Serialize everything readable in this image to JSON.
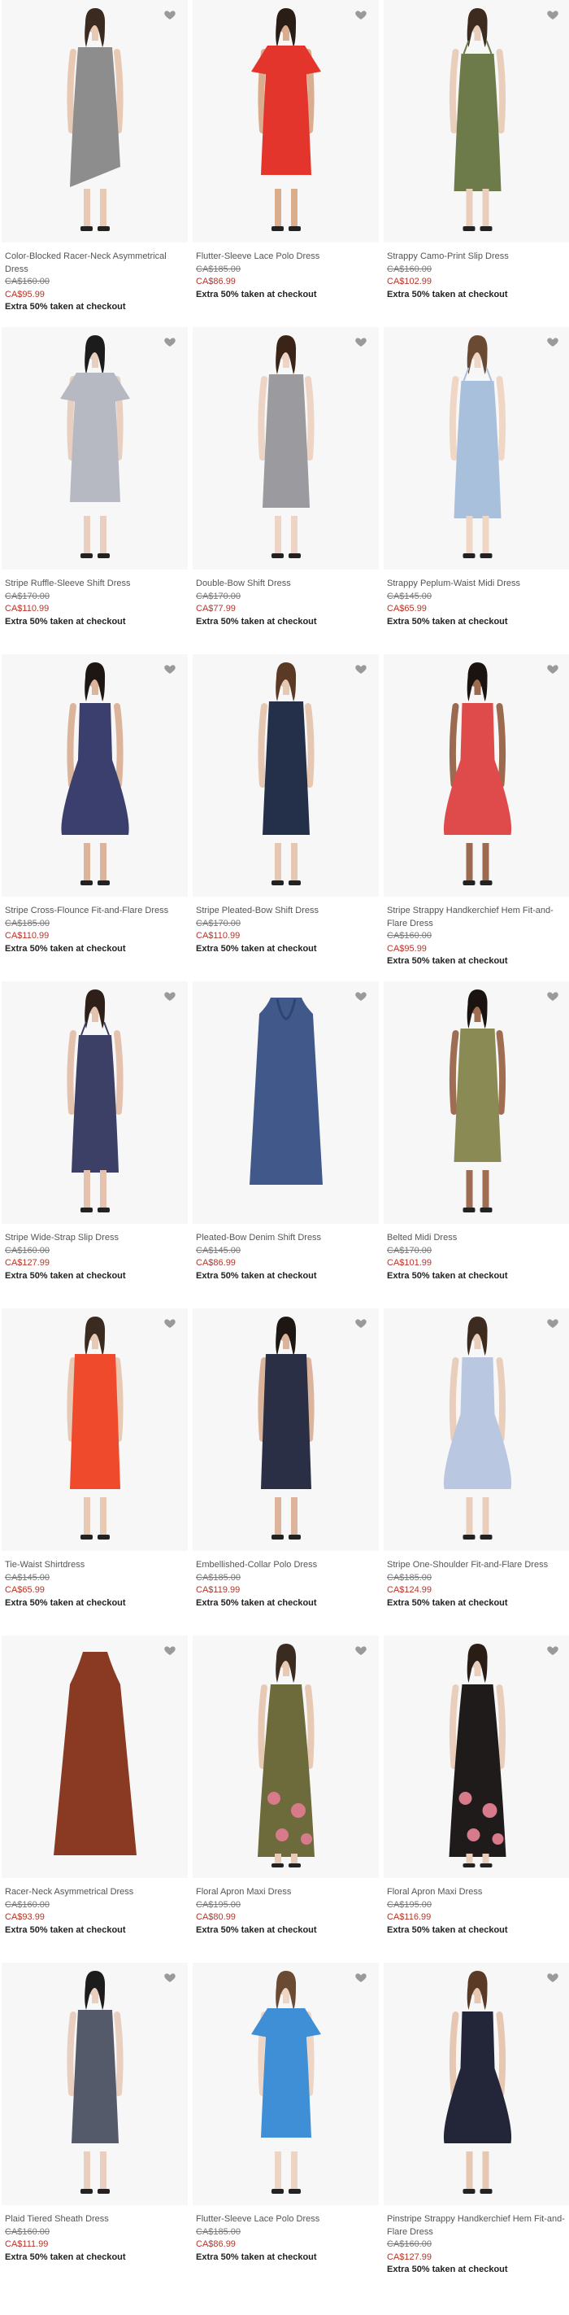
{
  "accent": {
    "sale": "#b5352a",
    "heart": "#9a9a9a"
  },
  "icons": {
    "favorite": "heart-icon"
  },
  "products": [
    {
      "name": "Color-Blocked Racer-Neck Asymmetrical Dress",
      "original": "CA$160.00",
      "sale": "CA$95.99",
      "promo": "Extra 50% taken at checkout",
      "dress_color": "#8d8d8d",
      "skin": "#e8c9b4",
      "hair": "#3a2a20",
      "style": "sheath-asym"
    },
    {
      "name": "Flutter-Sleeve Lace Polo Dress",
      "original": "CA$185.00",
      "sale": "CA$86.99",
      "promo": "Extra 50% taken at checkout",
      "dress_color": "#e3352c",
      "skin": "#d9ad8e",
      "hair": "#2a1d15",
      "style": "flutter"
    },
    {
      "name": "Strappy Camo-Print Slip Dress",
      "original": "CA$160.00",
      "sale": "CA$102.99",
      "promo": "Extra 50% taken at checkout",
      "dress_color": "#6d7a4a",
      "skin": "#e9cfbb",
      "hair": "#3d2b1f",
      "style": "slip"
    },
    {
      "name": "Stripe Ruffle-Sleeve Shift Dress",
      "original": "CA$170.00",
      "sale": "CA$110.99",
      "promo": "Extra 50% taken at checkout",
      "dress_color": "#b7b9c2",
      "skin": "#e8cfbf",
      "hair": "#1c1c1c",
      "style": "flutter"
    },
    {
      "name": "Double-Bow Shift Dress",
      "original": "CA$170.00",
      "sale": "CA$77.99",
      "promo": "Extra 50% taken at checkout",
      "dress_color": "#9a9a9f",
      "skin": "#edd4c4",
      "hair": "#3a2418",
      "style": "sheath"
    },
    {
      "name": "Strappy Peplum-Waist Midi Dress",
      "original": "CA$145.00",
      "sale": "CA$65.99",
      "promo": "Extra 50% taken at checkout",
      "dress_color": "#a9c0dc",
      "skin": "#f0d7c5",
      "hair": "#6b4a33",
      "style": "slip"
    },
    {
      "name": "Stripe Cross-Flounce Fit-and-Flare Dress",
      "original": "CA$185.00",
      "sale": "CA$110.99",
      "promo": "Extra 50% taken at checkout",
      "dress_color": "#3b3f6d",
      "skin": "#dcb49b",
      "hair": "#1e1612",
      "style": "flare"
    },
    {
      "name": "Stripe Pleated-Bow Shift Dress",
      "original": "CA$170.00",
      "sale": "CA$110.99",
      "promo": "Extra 50% taken at checkout",
      "dress_color": "#243049",
      "skin": "#e6c7b2",
      "hair": "#5a3a24",
      "style": "sheath"
    },
    {
      "name": "Stripe Strappy Handkerchief Hem Fit-and-Flare Dress",
      "original": "CA$160.00",
      "sale": "CA$95.99",
      "promo": "Extra 50% taken at checkout",
      "dress_color": "#df4b4b",
      "skin": "#9c6a4e",
      "hair": "#1a1310",
      "style": "flare-strap"
    },
    {
      "name": "Stripe Wide-Strap Slip Dress",
      "original": "CA$160.00",
      "sale": "CA$127.99",
      "promo": "Extra 50% taken at checkout",
      "dress_color": "#3c3f66",
      "skin": "#e4c2ad",
      "hair": "#2e2019",
      "style": "slip"
    },
    {
      "name": "Pleated-Bow Denim Shift Dress",
      "original": "CA$145.00",
      "sale": "CA$86.99",
      "promo": "Extra 50% taken at checkout",
      "dress_color": "#40598a",
      "skin": "#ffffff",
      "hair": "#ffffff",
      "style": "flat"
    },
    {
      "name": "Belted Midi Dress",
      "original": "CA$170.00",
      "sale": "CA$101.99",
      "promo": "Extra 50% taken at checkout",
      "dress_color": "#8a8a55",
      "skin": "#9f6e52",
      "hair": "#1a1310",
      "style": "sheath"
    },
    {
      "name": "Tie-Waist Shirtdress",
      "original": "CA$145.00",
      "sale": "CA$65.99",
      "promo": "Extra 50% taken at checkout",
      "dress_color": "#f04a2c",
      "skin": "#e8c9b4",
      "hair": "#3a2a20",
      "style": "shirt"
    },
    {
      "name": "Embellished-Collar Polo Dress",
      "original": "CA$185.00",
      "sale": "CA$119.99",
      "promo": "Extra 50% taken at checkout",
      "dress_color": "#2a2f45",
      "skin": "#dcb49b",
      "hair": "#1e1612",
      "style": "shirt"
    },
    {
      "name": "Stripe One-Shoulder Fit-and-Flare Dress",
      "original": "CA$185.00",
      "sale": "CA$124.99",
      "promo": "Extra 50% taken at checkout",
      "dress_color": "#b9c7e0",
      "skin": "#e9cfbb",
      "hair": "#3d2b1f",
      "style": "flare-strap"
    },
    {
      "name": "Racer-Neck Asymmetrical Dress",
      "original": "CA$160.00",
      "sale": "CA$93.99",
      "promo": "Extra 50% taken at checkout",
      "dress_color": "#8a3a22",
      "skin": "#ffffff",
      "hair": "#ffffff",
      "style": "flat-long"
    },
    {
      "name": "Floral Apron Maxi Dress",
      "original": "CA$195.00",
      "sale": "CA$80.99",
      "promo": "Extra 50% taken at checkout",
      "dress_color": "#6d6b3c",
      "skin": "#e8c9b4",
      "hair": "#3a2a20",
      "style": "maxi"
    },
    {
      "name": "Floral Apron Maxi Dress",
      "original": "CA$195.00",
      "sale": "CA$116.99",
      "promo": "Extra 50% taken at checkout",
      "dress_color": "#1f1b1b",
      "skin": "#e9cfbb",
      "hair": "#2a1d15",
      "style": "maxi"
    },
    {
      "name": "Plaid Tiered Sheath Dress",
      "original": "CA$160.00",
      "sale": "CA$111.99",
      "promo": "Extra 50% taken at checkout",
      "dress_color": "#555a6a",
      "skin": "#e8cfbf",
      "hair": "#1c1c1c",
      "style": "sheath"
    },
    {
      "name": "Flutter-Sleeve Lace Polo Dress",
      "original": "CA$185.00",
      "sale": "CA$86.99",
      "promo": "Extra 50% taken at checkout",
      "dress_color": "#3f8fd6",
      "skin": "#edd4c4",
      "hair": "#6b4a33",
      "style": "flutter"
    },
    {
      "name": "Pinstripe Strappy Handkerchief Hem Fit-and-Flare Dress",
      "original": "CA$160.00",
      "sale": "CA$127.99",
      "promo": "Extra 50% taken at checkout",
      "dress_color": "#232638",
      "skin": "#e6c7b2",
      "hair": "#5a3a24",
      "style": "flare-strap"
    }
  ]
}
